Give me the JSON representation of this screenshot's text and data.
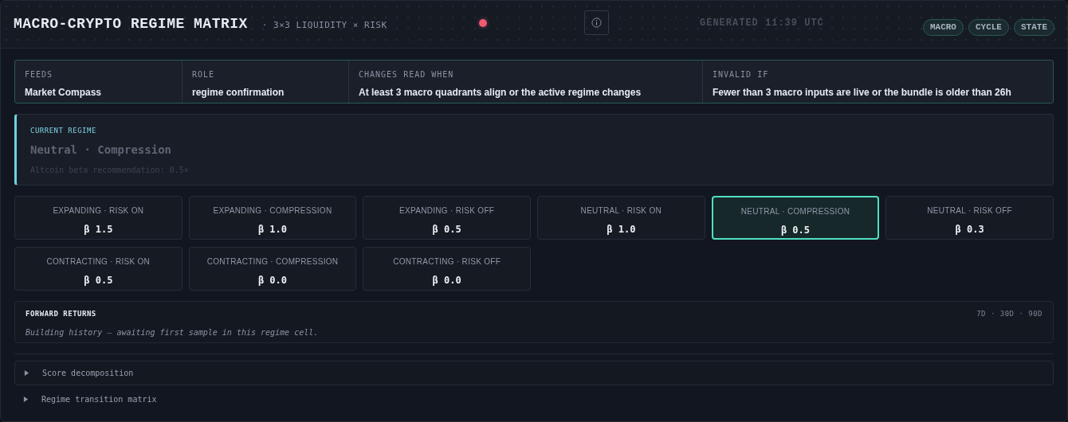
{
  "header": {
    "title": "MACRO-CRYPTO REGIME MATRIX",
    "subtitle": "· 3×3 LIQUIDITY × RISK",
    "generated": "GENERATED 11:39 UTC",
    "tags": [
      "MACRO",
      "CYCLE",
      "STATE"
    ]
  },
  "meta": [
    {
      "label": "FEEDS",
      "value": "Market Compass"
    },
    {
      "label": "ROLE",
      "value": "regime confirmation"
    },
    {
      "label": "CHANGES READ WHEN",
      "value": "At least 3 macro quadrants align or the active regime changes"
    },
    {
      "label": "INVALID IF",
      "value": "Fewer than 3 macro inputs are live or the bundle is older than 26h"
    }
  ],
  "current_regime": {
    "label": "CURRENT REGIME",
    "name": "Neutral · Compression",
    "note": "Altcoin beta recommendation: 0.5×"
  },
  "cells": [
    {
      "label": "EXPANDING · RISK ON",
      "beta": "β 1.5",
      "selected": false
    },
    {
      "label": "EXPANDING · COMPRESSION",
      "beta": "β 1.0",
      "selected": false
    },
    {
      "label": "EXPANDING · RISK OFF",
      "beta": "β 0.5",
      "selected": false
    },
    {
      "label": "NEUTRAL · RISK ON",
      "beta": "β 1.0",
      "selected": false
    },
    {
      "label": "NEUTRAL · COMPRESSION",
      "beta": "β 0.5",
      "selected": true
    },
    {
      "label": "NEUTRAL · RISK OFF",
      "beta": "β 0.3",
      "selected": false
    },
    {
      "label": "CONTRACTING · RISK ON",
      "beta": "β 0.5",
      "selected": false
    },
    {
      "label": "CONTRACTING · COMPRESSION",
      "beta": "β 0.0",
      "selected": false
    },
    {
      "label": "CONTRACTING · RISK OFF",
      "beta": "β 0.0",
      "selected": false
    }
  ],
  "forward_returns": {
    "title": "FORWARD RETURNS",
    "horizons": "7D · 30D · 90D",
    "message": "Building history — awaiting first sample in this regime cell."
  },
  "sections": [
    {
      "label": "Score decomposition",
      "expanded": false,
      "kind": "boxed"
    },
    {
      "label": "Regime transition matrix",
      "expanded": false,
      "kind": "plain"
    }
  ]
}
